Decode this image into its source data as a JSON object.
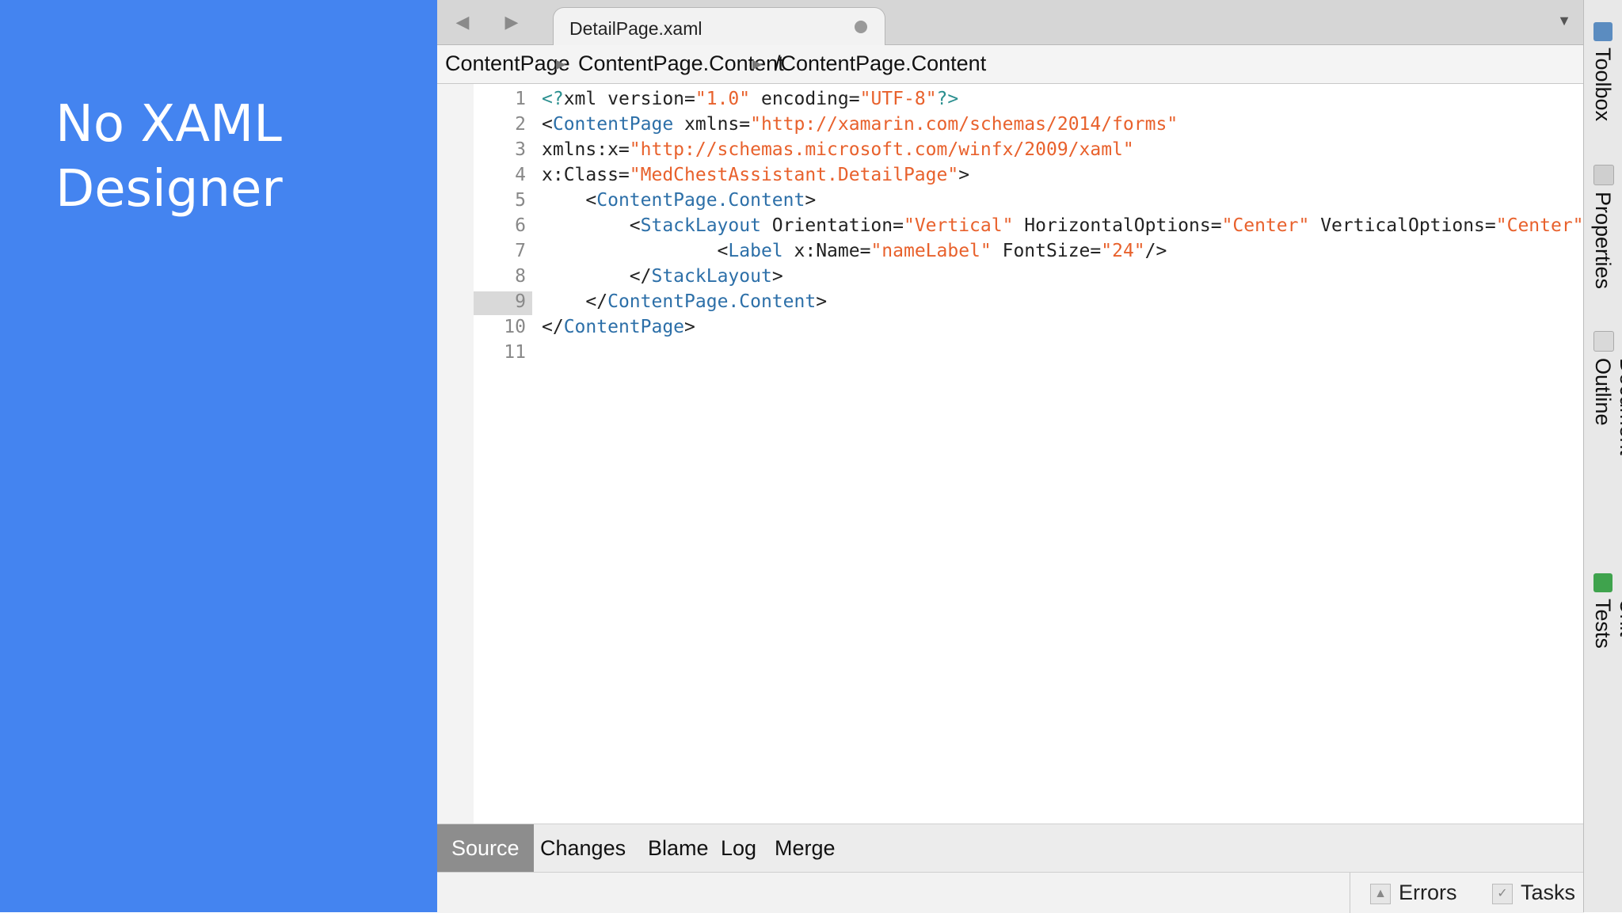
{
  "slide": {
    "title": "No XAML\nDesigner"
  },
  "ide": {
    "tab": {
      "filename": "DetailPage.xaml"
    },
    "breadcrumb": [
      "ContentPage",
      "ContentPage.Content",
      "/ContentPage.Content"
    ],
    "line_numbers": [
      "1",
      "2",
      "3",
      "4",
      "5",
      "6",
      "7",
      "8",
      "9",
      "10",
      "11"
    ],
    "current_line": 9,
    "code_lines": [
      "<?xml version=\"1.0\" encoding=\"UTF-8\"?>",
      "<ContentPage xmlns=\"http://xamarin.com/schemas/2014/forms\"",
      "xmlns:x=\"http://schemas.microsoft.com/winfx/2009/xaml\"",
      "x:Class=\"MedChestAssistant.DetailPage\">",
      "    <ContentPage.Content>",
      "        <StackLayout Orientation=\"Vertical\" HorizontalOptions=\"Center\" VerticalOptions=\"Center\">",
      "                <Label x:Name=\"nameLabel\" FontSize=\"24\"/>",
      "        </StackLayout>",
      "    </ContentPage.Content>",
      "</ContentPage>",
      ""
    ],
    "bottom_tabs": [
      "Source",
      "Changes",
      "Blame",
      "Log",
      "Merge"
    ],
    "active_bottom_tab": "Source",
    "status": {
      "errors_label": "Errors",
      "tasks_label": "Tasks"
    },
    "side_dock": [
      {
        "label": "Toolbox",
        "icon": "toolbox-icon"
      },
      {
        "label": "Properties",
        "icon": "properties-icon"
      },
      {
        "label": "Document Outline",
        "icon": "document-outline-icon"
      },
      {
        "label": "Unit Tests",
        "icon": "unit-tests-icon"
      }
    ],
    "colors": {
      "tag": "#2c6fa8",
      "string": "#e8612c",
      "processing_instruction": "#2a8f8f",
      "slide_background": "#4484f0"
    }
  }
}
